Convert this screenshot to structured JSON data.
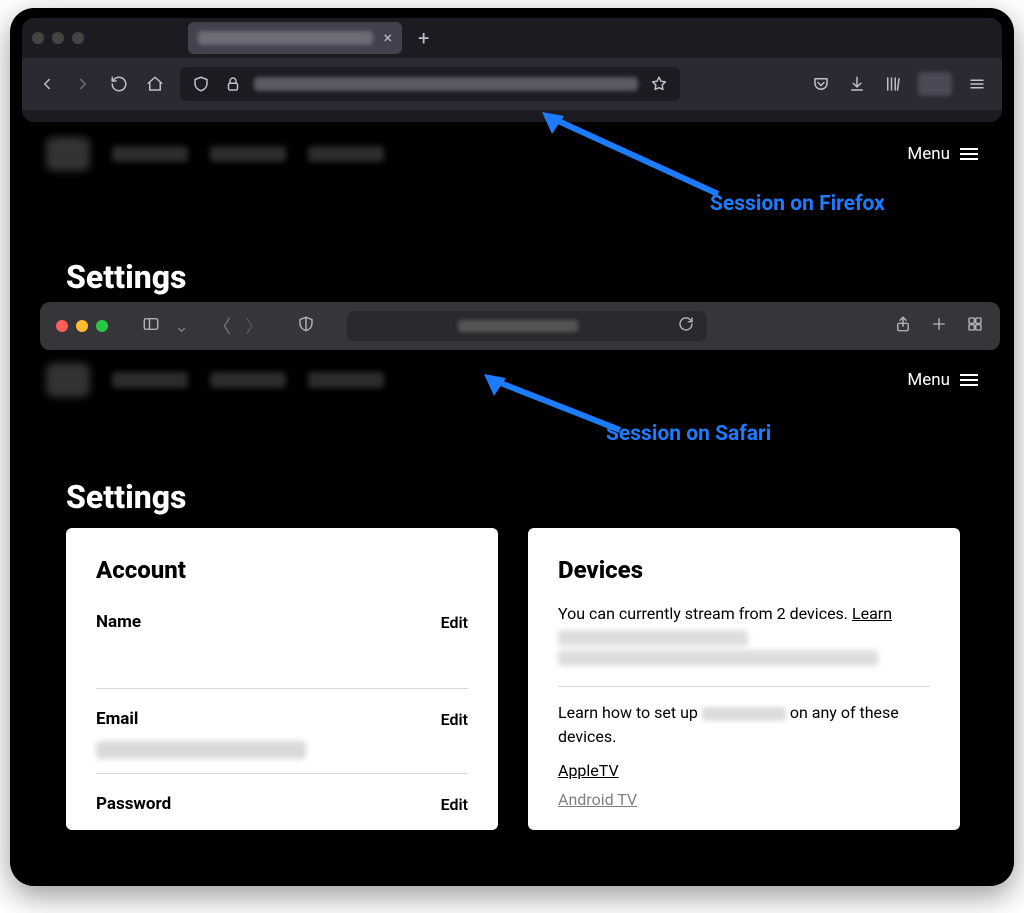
{
  "annotations": {
    "firefox": "Session on Firefox",
    "safari": "Session on Safari"
  },
  "settings_heading": "Settings",
  "site_menu_label": "Menu",
  "account": {
    "title": "Account",
    "name_label": "Name",
    "email_label": "Email",
    "password_label": "Password",
    "edit_label": "Edit"
  },
  "devices": {
    "title": "Devices",
    "line1_prefix": "You can currently stream from 2 devices. ",
    "learn": "Learn",
    "setup_prefix": "Learn how to set up ",
    "setup_suffix": " on any of these devices.",
    "list": [
      "AppleTV",
      "Android TV"
    ]
  }
}
